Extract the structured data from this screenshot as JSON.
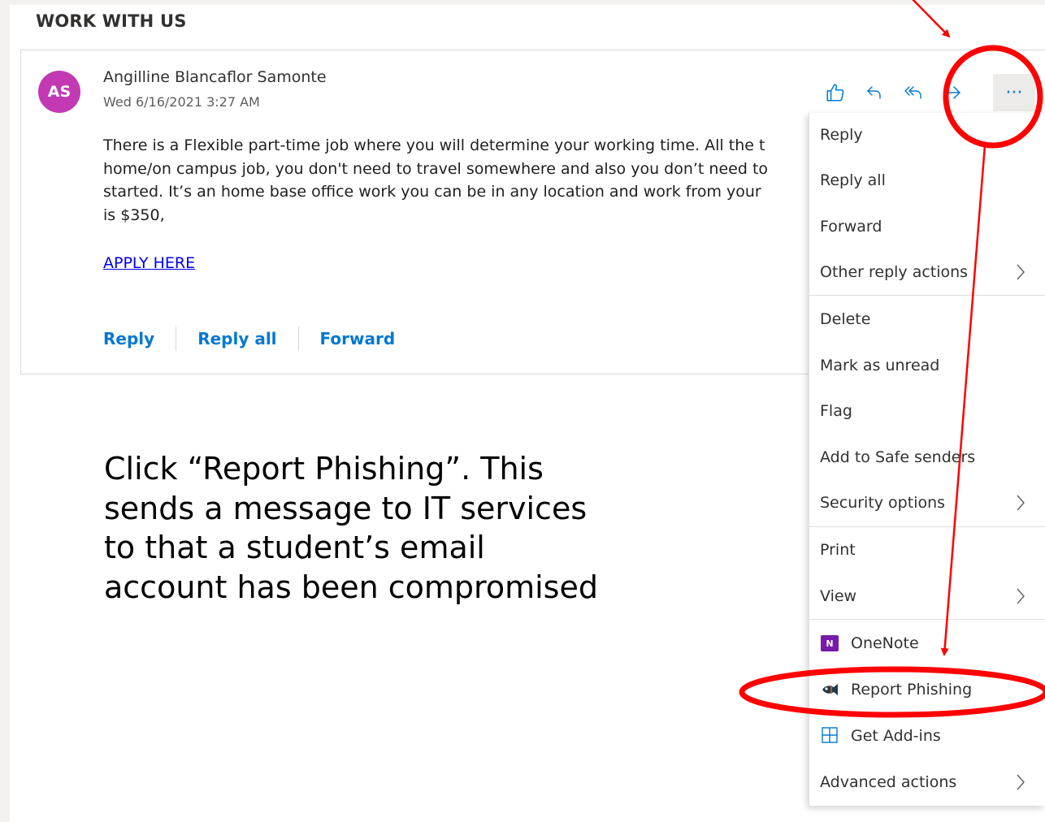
{
  "email": {
    "subject": "WORK WITH US",
    "avatar_initials": "AS",
    "avatar_color": "#c239b3",
    "sender": "Angilline Blancaflor Samonte",
    "date": "Wed 6/16/2021 3:27 AM",
    "body_lines": [
      "There is a Flexible part-time job where you will determine your working time. All the t",
      "home/on campus job, you don't need to travel somewhere and also you don’t need to",
      "started. It’s an home base office work you can be in any location and work from your",
      "is $350,"
    ],
    "link_text": "APPLY HERE",
    "actions": {
      "reply": "Reply",
      "reply_all": "Reply all",
      "forward": "Forward"
    }
  },
  "toolbar": {
    "icons": [
      "like-icon",
      "reply-icon",
      "reply-all-icon",
      "forward-icon",
      "more-icon"
    ],
    "more_label": "···"
  },
  "menu": {
    "items": [
      {
        "label": "Reply"
      },
      {
        "label": "Reply all"
      },
      {
        "label": "Forward"
      },
      {
        "label": "Other reply actions",
        "submenu": true
      },
      {
        "label": "Delete"
      },
      {
        "label": "Mark as unread"
      },
      {
        "label": "Flag"
      },
      {
        "label": "Add to Safe senders"
      },
      {
        "label": "Security options",
        "submenu": true
      },
      {
        "label": "Print"
      },
      {
        "label": "View",
        "submenu": true
      },
      {
        "label": "OneNote",
        "icon": "onenote-icon"
      },
      {
        "label": "Report Phishing",
        "icon": "phishing-fish-icon"
      },
      {
        "label": "Get Add-ins",
        "icon": "add-ins-icon"
      },
      {
        "label": "Advanced actions",
        "submenu": true
      }
    ]
  },
  "annotation": {
    "instruction": "Click “Report Phishing”. This sends a message to IT services to that a student’s email account has been compromised",
    "instruction_lines": [
      "Click “Report Phishing”. This",
      "sends a message to IT services",
      "to that a student’s email",
      "account has been compromised"
    ],
    "highlight_color": "#ff0000"
  },
  "colors": {
    "accent": "#0078d4",
    "link": "#0000ee",
    "text": "#323130"
  }
}
